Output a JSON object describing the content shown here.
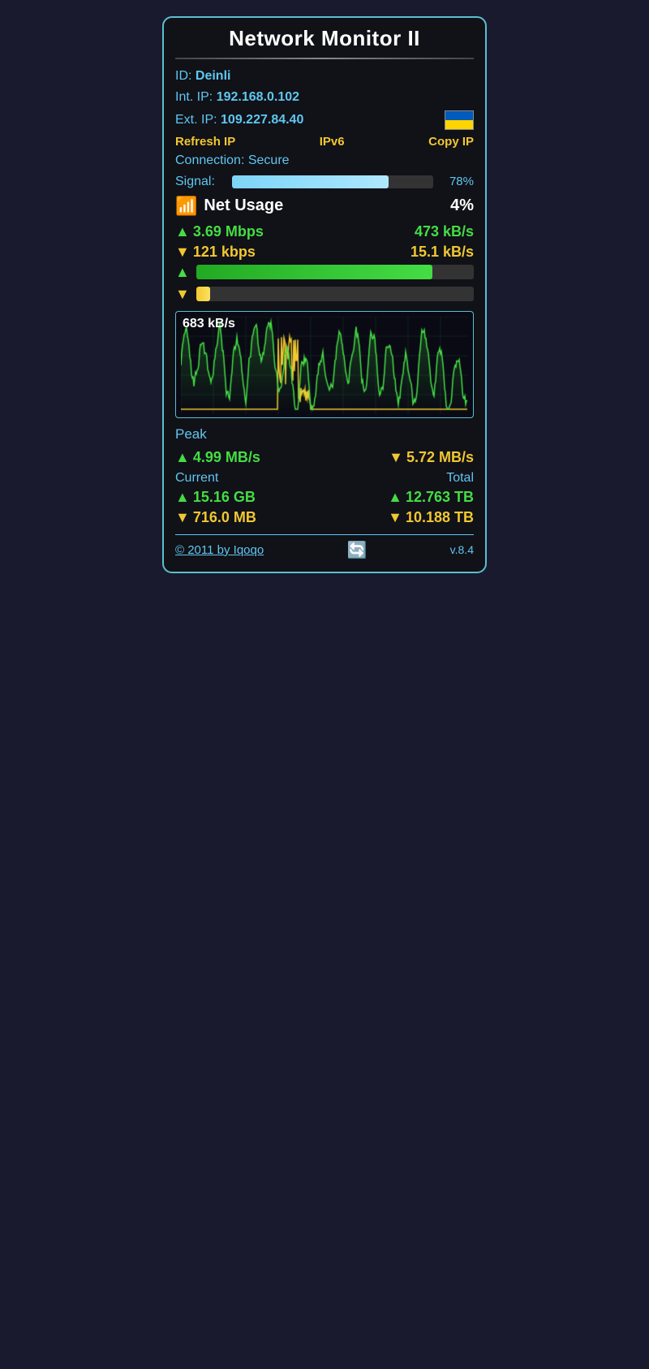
{
  "widget": {
    "title": "Network Monitor II",
    "id_label": "ID:",
    "id_value": "Deinli",
    "int_ip_label": "Int. IP:",
    "int_ip_value": "192.168.0.102",
    "ext_ip_label": "Ext. IP:",
    "ext_ip_value": "109.227.84.40",
    "action_refresh": "Refresh IP",
    "action_ipv6": "IPv6",
    "action_copy": "Copy IP",
    "connection_label": "Connection:",
    "connection_value": "Secure",
    "signal_label": "Signal:",
    "signal_pct": "78%",
    "signal_value": 78,
    "net_usage_label": "Net Usage",
    "net_usage_pct": "4%",
    "upload_mbps": "3.69 Mbps",
    "upload_kbs": "473 kB/s",
    "download_kbps": "121 kbps",
    "download_kbs": "15.1 kB/s",
    "upload_bar_pct": 85,
    "download_bar_pct": 5,
    "chart_label": "683 kB/s",
    "peak_title": "Peak",
    "peak_up": "4.99 MB/s",
    "peak_down": "5.72 MB/s",
    "current_label": "Current",
    "total_label": "Total",
    "current_up": "15.16 GB",
    "current_down": "716.0 MB",
    "total_up": "12.763 TB",
    "total_down": "10.188 TB",
    "footer_link": "© 2011 by Iqoqo",
    "footer_version": "v.8.4"
  }
}
